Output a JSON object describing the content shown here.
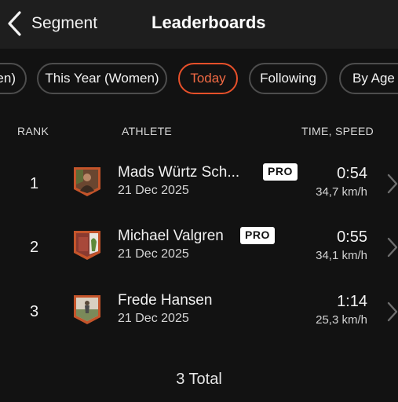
{
  "header": {
    "back_label": "Segment",
    "title": "Leaderboards"
  },
  "filters": [
    {
      "label": "en)",
      "active": false
    },
    {
      "label": "This Year (Women)",
      "active": false
    },
    {
      "label": "Today",
      "active": true
    },
    {
      "label": "Following",
      "active": false
    },
    {
      "label": "By Age (",
      "active": false
    }
  ],
  "columns": {
    "rank": "RANK",
    "athlete": "ATHLETE",
    "time_speed": "TIME, SPEED"
  },
  "rows": [
    {
      "rank": "1",
      "name": "Mads Würtz Sch...",
      "date": "21 Dec 2025",
      "badge": "PRO",
      "time": "0:54",
      "speed": "34,7 km/h"
    },
    {
      "rank": "2",
      "name": "Michael  Valgren",
      "date": "21 Dec 2025",
      "badge": "PRO",
      "time": "0:55",
      "speed": "34,1 km/h"
    },
    {
      "rank": "3",
      "name": "Frede Hansen",
      "date": "21 Dec 2025",
      "badge": "",
      "time": "1:14",
      "speed": "25,3 km/h"
    }
  ],
  "footer": {
    "total": "3 Total"
  },
  "colors": {
    "accent": "#e8502a",
    "background": "#121212",
    "header_bg": "#1e1e1e",
    "chip_border": "#4d4d4d"
  },
  "icons": {
    "back": "chevron-left-icon",
    "row_arrow": "chevron-right-icon",
    "avatar": "athlete-avatar-shield"
  }
}
